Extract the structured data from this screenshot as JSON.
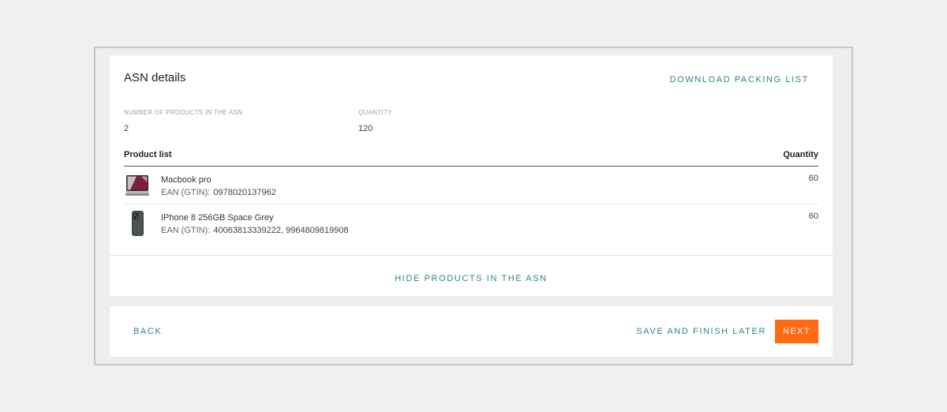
{
  "asn": {
    "title": "ASN details",
    "download_label": "DOWNLOAD PACKING LIST",
    "num_products_label": "NUMBER OF PRODUCTS IN THE ASN",
    "num_products_value": "2",
    "quantity_label": "QUANTITY",
    "quantity_value": "120",
    "hide_label": "HIDE PRODUCTS IN THE ASN"
  },
  "table": {
    "col_product": "Product list",
    "col_quantity": "Quantity"
  },
  "products": [
    {
      "name": "Macbook pro",
      "ean_label": "EAN (GTIN):",
      "ean_value": "0978020137962",
      "quantity": "60",
      "icon": "laptop-icon"
    },
    {
      "name": "IPhone 8 256GB Space Grey",
      "ean_label": "EAN (GTIN):",
      "ean_value": "40063813339222, 9964809819908",
      "quantity": "60",
      "icon": "phone-icon"
    }
  ],
  "footer": {
    "back_label": "BACK",
    "save_label": "SAVE AND FINISH LATER",
    "next_label": "NEXT"
  },
  "colors": {
    "accent_link": "#2e8589",
    "primary_button": "#ff6a13",
    "background": "#eef0f2"
  }
}
